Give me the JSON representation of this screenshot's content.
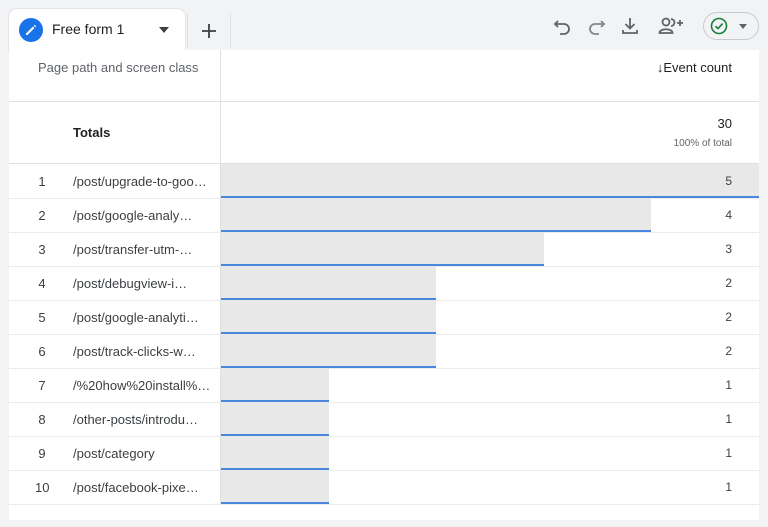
{
  "tab": {
    "title": "Free form 1",
    "icon": "pencil-icon"
  },
  "toolbar": {
    "icons": [
      "undo-icon",
      "redo-icon",
      "download-icon",
      "share-user-icon",
      "check-circle-icon"
    ],
    "accent": "#1a73e8",
    "status_color": "#188038"
  },
  "table": {
    "dimension_header": "Page path and screen class",
    "metric_header": "↓Event count",
    "totals_label": "Totals",
    "totals_value": "30",
    "totals_sub": "100% of total",
    "bar_color": "#4a85e0",
    "rows": [
      {
        "index": "1",
        "path": "/post/upgrade-to-goo…",
        "value": 5
      },
      {
        "index": "2",
        "path": "/post/google-analy…",
        "value": 4
      },
      {
        "index": "3",
        "path": "/post/transfer-utm-…",
        "value": 3
      },
      {
        "index": "4",
        "path": "/post/debugview-i…",
        "value": 2
      },
      {
        "index": "5",
        "path": "/post/google-analyti…",
        "value": 2
      },
      {
        "index": "6",
        "path": "/post/track-clicks-w…",
        "value": 2
      },
      {
        "index": "7",
        "path": "/%20how%20install%…",
        "value": 1
      },
      {
        "index": "8",
        "path": "/other-posts/introdu…",
        "value": 1
      },
      {
        "index": "9",
        "path": "/post/category",
        "value": 1
      },
      {
        "index": "10",
        "path": "/post/facebook-pixe…",
        "value": 1
      }
    ]
  }
}
